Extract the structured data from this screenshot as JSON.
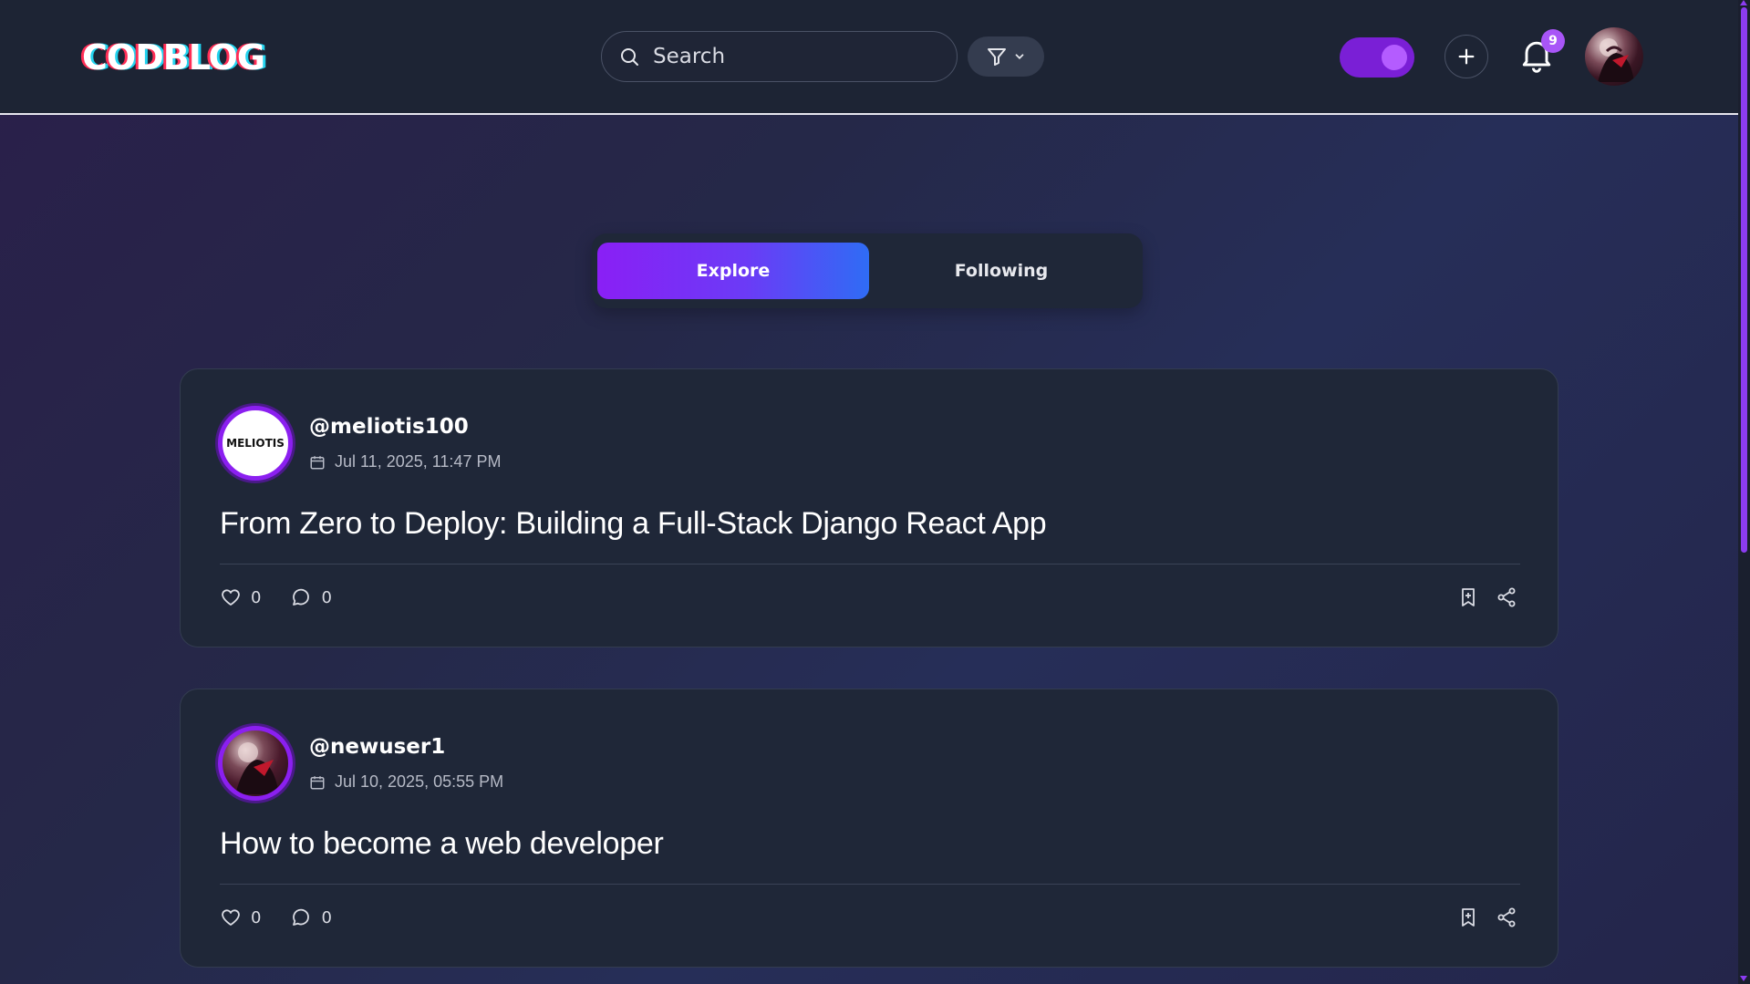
{
  "header": {
    "logo_text": "CODBLOG",
    "search_placeholder": "Search",
    "notification_count": "9"
  },
  "tabs": [
    {
      "label": "Explore",
      "active": true
    },
    {
      "label": "Following",
      "active": false
    }
  ],
  "posts": [
    {
      "username": "@meliotis100",
      "avatar_text": "MELIOTIS",
      "date": "Jul 11, 2025, 11:47 PM",
      "title": "From Zero to Deploy: Building a Full-Stack Django React App",
      "likes": "0",
      "comments": "0"
    },
    {
      "username": "@newuser1",
      "date": "Jul 10, 2025, 05:55 PM",
      "title": "How to become a web developer",
      "likes": "0",
      "comments": "0"
    }
  ],
  "colors": {
    "accent_purple": "#8a1ff5",
    "accent_blue": "#2f6cf5",
    "card_bg": "#1f2738",
    "header_bg": "#1d2434"
  },
  "icons": [
    "search-icon",
    "filter-icon",
    "chevron-down-icon",
    "plus-icon",
    "bell-icon",
    "calendar-icon",
    "heart-icon",
    "comment-icon",
    "bookmark-icon",
    "share-icon"
  ]
}
